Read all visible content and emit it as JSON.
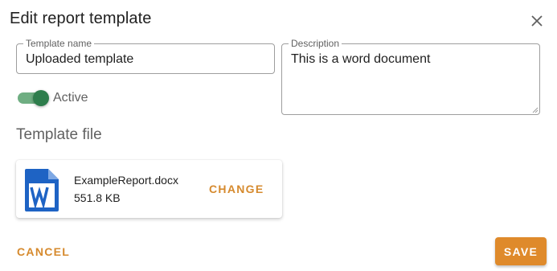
{
  "dialog": {
    "title": "Edit report template"
  },
  "icons": {
    "close": "close-icon",
    "file": "word-document-icon"
  },
  "form": {
    "template_name": {
      "label": "Template name",
      "value": "Uploaded template"
    },
    "description": {
      "label": "Description",
      "value": "This is a word document"
    },
    "active": {
      "label": "Active",
      "checked": true
    }
  },
  "template_file": {
    "section_title": "Template file",
    "file_name": "ExampleReport.docx",
    "file_size": "551.8 KB",
    "change_label": "CHANGE"
  },
  "actions": {
    "cancel_label": "CANCEL",
    "save_label": "SAVE"
  },
  "colors": {
    "accent": "#df8a2b",
    "toggle_on": "#2e7d4c",
    "word_blue": "#1e63c4"
  }
}
